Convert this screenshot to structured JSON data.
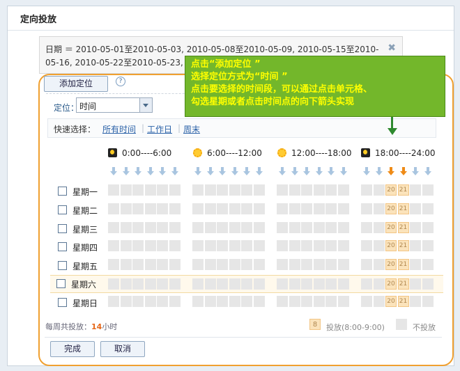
{
  "page": {
    "title": "定向投放"
  },
  "date_box": {
    "text": "日期 ＝ 2010-05-01至2010-05-03, 2010-05-08至2010-05-09, 2010-05-15至2010-05-16, 2010-05-22至2010-05-23,",
    "close": "✖"
  },
  "toolbar": {
    "add_location": "添加定位",
    "help": "?"
  },
  "location": {
    "label": "定位：",
    "selected": "时间"
  },
  "quick_select": {
    "label": "快速选择：",
    "options": [
      "所有时间",
      "工作日",
      "周末"
    ]
  },
  "periods": [
    {
      "label": "0:00----6:00",
      "icon": "moon-icon"
    },
    {
      "label": "6:00----12:00",
      "icon": "sun-icon"
    },
    {
      "label": "12:00----18:00",
      "icon": "sun-icon"
    },
    {
      "label": "18:00----24:00",
      "icon": "moon-icon"
    }
  ],
  "days": [
    "星期一",
    "星期二",
    "星期三",
    "星期四",
    "星期五",
    "星期六",
    "星期日"
  ],
  "highlighted_day": "星期六",
  "selected_hours": [
    20,
    21
  ],
  "footer": {
    "prefix": "每周共投放：",
    "hours": "14",
    "suffix": "小时"
  },
  "legend": {
    "on_sample": "8",
    "on_label": "投放(8:00-9:00)",
    "off_label": "不投放"
  },
  "buttons": {
    "done": "完成",
    "cancel": "取消"
  },
  "callout": {
    "lines": [
      "点击“添加定位 ”",
      "选择定位方式为“时间 ”",
      "点击要选择的时间段，可以通过点击单元格、",
      "勾选星期或者点击时间点的向下箭头实现"
    ]
  },
  "colors": {
    "accent_orange": "#f0a030",
    "callout_green": "#73b72b",
    "callout_text": "#ffff00",
    "selected_cell": "#fbe3bb",
    "empty_cell": "#e6e6e6"
  }
}
